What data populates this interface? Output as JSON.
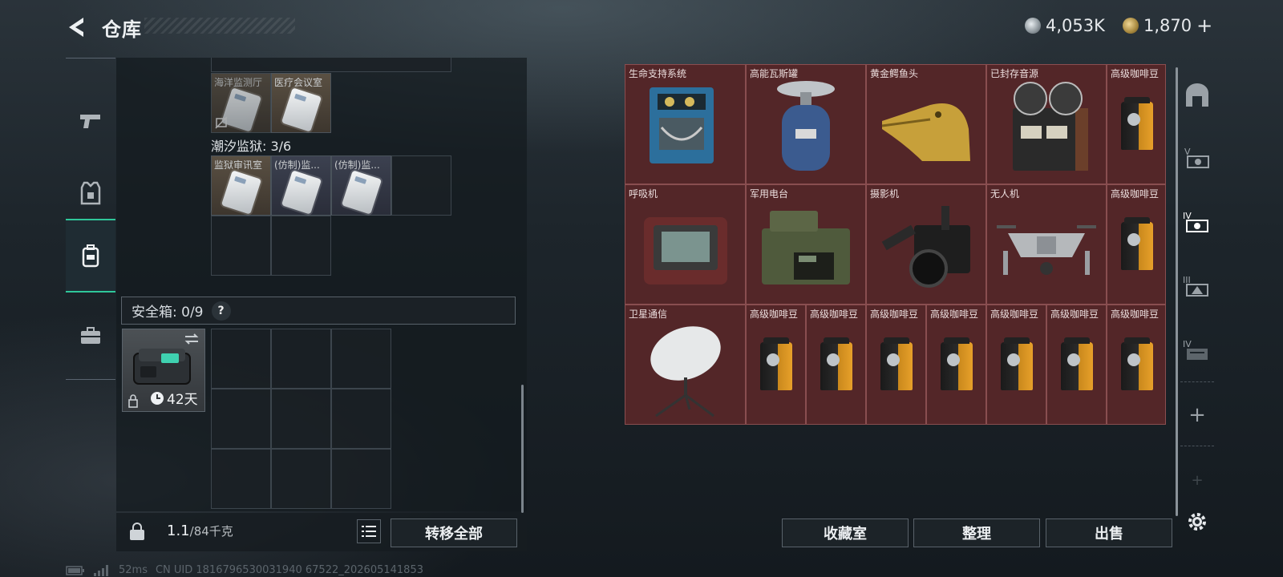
{
  "header": {
    "title": "仓库",
    "currency_silver": "4,053K",
    "currency_gold": "1,870",
    "gold_plus": "+"
  },
  "left_nav": {
    "items": [
      {
        "name": "weapons",
        "icon": "pistol-icon"
      },
      {
        "name": "armor",
        "icon": "armor-icon"
      },
      {
        "name": "backpack",
        "icon": "backpack-icon",
        "active": true
      },
      {
        "name": "briefcase",
        "icon": "briefcase-icon"
      }
    ]
  },
  "keys_section_top": {
    "items": [
      {
        "label": "海洋监测厅",
        "color": "tan",
        "disabled": true
      },
      {
        "label": "医疗会议室",
        "color": "tan"
      }
    ]
  },
  "prison_section": {
    "label": "潮汐监狱: 3/6",
    "items": [
      {
        "label": "监狱审讯室",
        "color": "tan"
      },
      {
        "label": "(仿制)监...",
        "color": "blue"
      },
      {
        "label": "(仿制)监...",
        "color": "blue"
      }
    ]
  },
  "safebox": {
    "label": "安全箱: 0/9",
    "help": "?",
    "days": "42天"
  },
  "bottom_left": {
    "weight_value": "1.1",
    "weight_capacity": "/84千克",
    "transfer_all": "转移全部"
  },
  "grid_items": [
    {
      "name": "生命支持系统"
    },
    {
      "name": "高能瓦斯罐"
    },
    {
      "name": "黄金鳄鱼头"
    },
    {
      "name": "已封存音源"
    },
    {
      "name": "高级咖啡豆"
    },
    {
      "name": "呼吸机"
    },
    {
      "name": "军用电台"
    },
    {
      "name": "摄影机"
    },
    {
      "name": "无人机"
    },
    {
      "name": "高级咖啡豆"
    },
    {
      "name": "卫星通信"
    },
    {
      "name": "高级咖啡豆"
    },
    {
      "name": "高级咖啡豆"
    },
    {
      "name": "高级咖啡豆"
    },
    {
      "name": "高级咖啡豆"
    },
    {
      "name": "高级咖啡豆"
    },
    {
      "name": "高级咖啡豆"
    },
    {
      "name": "高级咖啡豆"
    }
  ],
  "right_tabs": {
    "roman": [
      "V",
      "IV",
      "III",
      "IV"
    ],
    "plus": "+"
  },
  "bottom_right": {
    "collection": "收藏室",
    "sort": "整理",
    "sell": "出售"
  },
  "status": {
    "ping": "52ms",
    "uid": "CN UID 1816796530031940 67522_202605141853"
  },
  "colors": {
    "accent": "#2fc79a",
    "grid_bg": "#4c2526"
  }
}
